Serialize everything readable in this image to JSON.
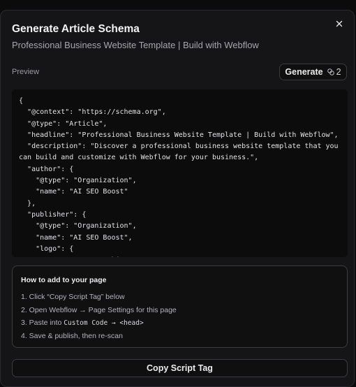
{
  "modal": {
    "title": "Generate Article Schema",
    "subtitle": "Professional Business Website Template | Build with Webflow",
    "preview_label": "Preview",
    "generate_label": "Generate",
    "generate_count": "2",
    "code": "{\n  \"@context\": \"https://schema.org\",\n  \"@type\": \"Article\",\n  \"headline\": \"Professional Business Website Template | Build with Webflow\",\n  \"description\": \"Discover a professional business website template that you can build and customize with Webflow for your business.\",\n  \"author\": {\n    \"@type\": \"Organization\",\n    \"name\": \"AI SEO Boost\"\n  },\n  \"publisher\": {\n    \"@type\": \"Organization\",\n    \"name\": \"AI SEO Boost\",\n    \"logo\": {\n      \"@type\": \"ImageObject\",\n      \"url\": \"\"\n    }\n  }\n}",
    "howto": {
      "title": "How to add to your page",
      "step1": "1. Click “Copy Script Tag” below",
      "step2": "2. Open Webflow → Page Settings for this page",
      "step3_prefix": "3. Paste into ",
      "step3_code": "Custom Code → <head>",
      "step4": "4. Save & publish, then re-scan"
    },
    "copy_label": "Copy Script Tag",
    "icons": {
      "close": "close-icon",
      "credits": "coins-icon"
    }
  }
}
